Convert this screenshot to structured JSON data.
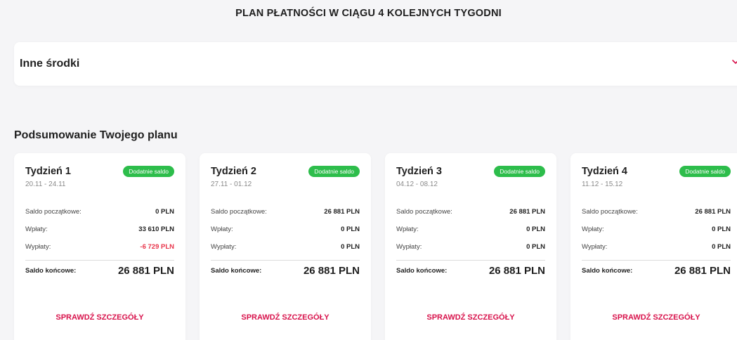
{
  "page_title": "PLAN PŁATNOŚCI W CIĄGU 4 KOLEJNYCH TYGODNI",
  "accordion": {
    "label": "Inne środki",
    "icon": "chevron-down-icon"
  },
  "summary_title": "Podsumowanie Twojego planu",
  "colors": {
    "accent": "#d8134c",
    "positive_badge": "#2dbd4b",
    "negative": "#e8344a"
  },
  "weeks": [
    {
      "title": "Tydzień 1",
      "dates": "20.11 - 24.11",
      "badge": "Dodatnie saldo",
      "rows": [
        {
          "label": "Saldo początkowe:",
          "value": "0 PLN"
        },
        {
          "label": "Wpłaty:",
          "value": "33 610 PLN"
        },
        {
          "label": "Wypłaty:",
          "value": "-6 729 PLN"
        }
      ],
      "total_label": "Saldo końcowe:",
      "total_value": "26 881 PLN",
      "link": "SPRAWDŹ SZCZEGÓŁY"
    },
    {
      "title": "Tydzień 2",
      "dates": "27.11 - 01.12",
      "badge": "Dodatnie saldo",
      "rows": [
        {
          "label": "Saldo początkowe:",
          "value": "26 881 PLN"
        },
        {
          "label": "Wpłaty:",
          "value": "0 PLN"
        },
        {
          "label": "Wypłaty:",
          "value": "0 PLN"
        }
      ],
      "total_label": "Saldo końcowe:",
      "total_value": "26 881 PLN",
      "link": "SPRAWDŹ SZCZEGÓŁY"
    },
    {
      "title": "Tydzień 3",
      "dates": "04.12 - 08.12",
      "badge": "Dodatnie saldo",
      "rows": [
        {
          "label": "Saldo początkowe:",
          "value": "26 881 PLN"
        },
        {
          "label": "Wpłaty:",
          "value": "0 PLN"
        },
        {
          "label": "Wypłaty:",
          "value": "0 PLN"
        }
      ],
      "total_label": "Saldo końcowe:",
      "total_value": "26 881 PLN",
      "link": "SPRAWDŹ SZCZEGÓŁY"
    },
    {
      "title": "Tydzień 4",
      "dates": "11.12 - 15.12",
      "badge": "Dodatnie saldo",
      "rows": [
        {
          "label": "Saldo początkowe:",
          "value": "26 881 PLN"
        },
        {
          "label": "Wpłaty:",
          "value": "0 PLN"
        },
        {
          "label": "Wypłaty:",
          "value": "0 PLN"
        }
      ],
      "total_label": "Saldo końcowe:",
      "total_value": "26 881 PLN",
      "link": "SPRAWDŹ SZCZEGÓŁY"
    }
  ]
}
